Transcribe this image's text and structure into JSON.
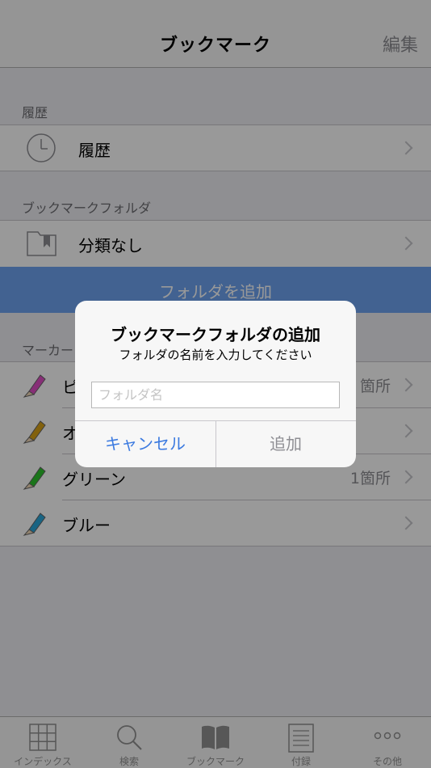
{
  "navbar": {
    "title": "ブックマーク",
    "edit_label": "編集"
  },
  "sections": {
    "history_header": "履歴",
    "folders_header": "ブックマークフォルダ",
    "markers_header": "マーカー"
  },
  "history_item": {
    "label": "履歴",
    "icon": "clock-icon"
  },
  "folder_item": {
    "label": "分類なし",
    "icon": "folder-icon"
  },
  "add_folder_label": "フォルダを追加",
  "markers": [
    {
      "label": "ピ",
      "count": "箇所",
      "color": "#e24fc6",
      "icon": "pink-marker-icon"
    },
    {
      "label": "オ",
      "count": "",
      "color": "#d9a216",
      "icon": "orange-marker-icon"
    },
    {
      "label": "グリーン",
      "count": "1箇所",
      "color": "#2cc42c",
      "icon": "green-marker-icon"
    },
    {
      "label": "ブルー",
      "count": "",
      "color": "#2aa7da",
      "icon": "blue-marker-icon"
    }
  ],
  "tabs": [
    {
      "label": "インデックス",
      "icon": "grid-icon"
    },
    {
      "label": "検索",
      "icon": "search-icon"
    },
    {
      "label": "ブックマーク",
      "icon": "book-icon"
    },
    {
      "label": "付録",
      "icon": "document-icon"
    },
    {
      "label": "その他",
      "icon": "more-icon"
    }
  ],
  "dialog": {
    "title": "ブックマークフォルダの追加",
    "message": "フォルダの名前を入力してください",
    "input_placeholder": "フォルダ名",
    "input_value": "",
    "cancel_label": "キャンセル",
    "add_label": "追加"
  }
}
